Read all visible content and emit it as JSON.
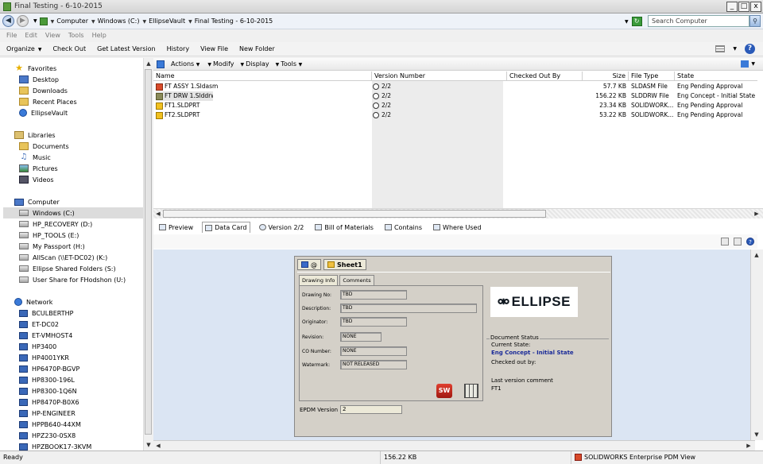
{
  "window": {
    "title": "Final Testing - 6-10-2015",
    "min": "_",
    "max": "□",
    "close": "x"
  },
  "address": {
    "crumbs": [
      "Computer",
      "Windows (C:)",
      "EllipseVault",
      "Final Testing - 6-10-2015"
    ],
    "search_placeholder": "Search Computer"
  },
  "menu": [
    "File",
    "Edit",
    "View",
    "Tools",
    "Help"
  ],
  "commands": {
    "organize": "Organize",
    "items": [
      "Check Out",
      "Get Latest Version",
      "History",
      "View File",
      "New Folder"
    ]
  },
  "sidebar": {
    "favorites": {
      "label": "Favorites",
      "items": [
        "Desktop",
        "Downloads",
        "Recent Places",
        "EllipseVault"
      ]
    },
    "libraries": {
      "label": "Libraries",
      "items": [
        "Documents",
        "Music",
        "Pictures",
        "Videos"
      ]
    },
    "computer": {
      "label": "Computer",
      "items": [
        "Windows (C:)",
        "HP_RECOVERY (D:)",
        "HP_TOOLS (E:)",
        "My Passport (H:)",
        "AllScan (\\\\ET-DC02) (K:)",
        "Ellipse Shared Folders (S:)",
        "User Share for FHodshon (U:)"
      ]
    },
    "network": {
      "label": "Network",
      "items": [
        "BCULBERTHP",
        "ET-DC02",
        "ET-VMHOST4",
        "HP3400",
        "HP4001YKR",
        "HP6470P-BGVP",
        "HP8300-196L",
        "HP8300-1Q6N",
        "HP8470P-B0X6",
        "HP-ENGINEER",
        "HPPB640-44XM",
        "HPZ230-0SX8",
        "HPZBOOK17-3KVM"
      ]
    }
  },
  "pdm_toolbar": {
    "items": [
      "Actions",
      "Modify",
      "Display",
      "Tools"
    ]
  },
  "columns": [
    "Name",
    "Version Number",
    "Checked Out By",
    "Size",
    "File Type",
    "State"
  ],
  "files": [
    {
      "name": "FT ASSY 1.Sldasm",
      "version": "2/2",
      "checked_out": "",
      "size": "57.7 KB",
      "type": "SLDASM File",
      "state": "Eng Pending Approval",
      "icon": "assembly-icon"
    },
    {
      "name": "FT DRW 1.Slddrw",
      "version": "2/2",
      "checked_out": "",
      "size": "156.22 KB",
      "type": "SLDDRW File",
      "state": "Eng Concept - Initial State",
      "icon": "drawing-icon"
    },
    {
      "name": "FT1.SLDPRT",
      "version": "2/2",
      "checked_out": "",
      "size": "23.34 KB",
      "type": "SOLIDWORK...",
      "state": "Eng Pending Approval",
      "icon": "part-icon"
    },
    {
      "name": "FT2.SLDPRT",
      "version": "2/2",
      "checked_out": "",
      "size": "53.22 KB",
      "type": "SOLIDWORK...",
      "state": "Eng Pending Approval",
      "icon": "part-icon"
    }
  ],
  "tabs": [
    "Preview",
    "Data Card",
    "Version 2/2",
    "Bill of Materials",
    "Contains",
    "Where Used"
  ],
  "card": {
    "tab1": "@",
    "tab2": "Sheet1",
    "subtabs": [
      "Drawing Info",
      "Comments"
    ],
    "fields": [
      {
        "label": "Drawing No:",
        "value": "TBD"
      },
      {
        "label": "Description:",
        "value": "TBD"
      },
      {
        "label": "Originator:",
        "value": "TBD"
      },
      {
        "label": "Revision:",
        "value": "NONE"
      },
      {
        "label": "CO Number:",
        "value": "NONE"
      },
      {
        "label": "Watermark:",
        "value": "NOT RELEASED"
      }
    ],
    "logo_text": "ELLIPSE",
    "doc_status": {
      "group": "Document Status",
      "current_state_label": "Current State:",
      "current_state": "Eng Concept - Initial State",
      "checked_out_by": "Checked out by:",
      "last_comment_label": "Last version comment",
      "last_comment": "FT1"
    },
    "epdm_label": "EPDM Version",
    "epdm_value": "2"
  },
  "status": {
    "left": "Ready",
    "size": "156.22 KB",
    "app": "SOLIDWORKS Enterprise PDM View"
  }
}
